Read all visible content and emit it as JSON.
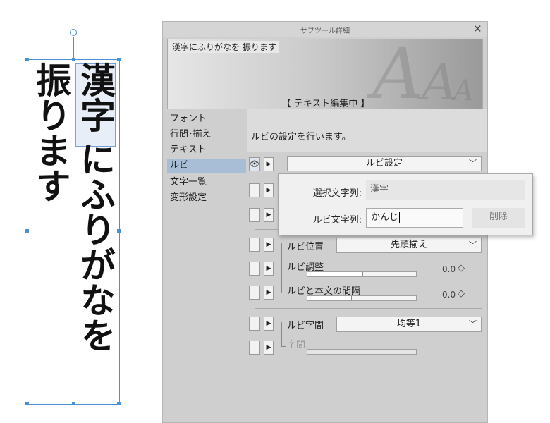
{
  "canvas": {
    "kanji": "漢字",
    "right_rest": "にふりがなを",
    "left_column": "振ります"
  },
  "panel": {
    "title": "サブツール詳細",
    "close_glyph": "✕",
    "preview": {
      "tool_name": "漢字にふりがなを 振ります",
      "status": "【 テキスト編集中 】",
      "glyph_A": "A"
    },
    "categories": [
      "フォント",
      "行間･揃え",
      "テキスト",
      "ルビ",
      "文字一覧",
      "変形設定"
    ],
    "selected_category": "ルビ",
    "description": "ルビの設定を行います。",
    "ruby_setting_label": "ルビ設定",
    "ruby_position_label": "ルビ位置",
    "ruby_position_value": "先頭揃え",
    "ruby_adjust_label": "ルビ調整",
    "ruby_adjust_value": "0.0",
    "ruby_gap_label": "ルビと本文の間隔",
    "ruby_gap_value": "0.0",
    "ruby_spacing_label": "ルビ字間",
    "ruby_spacing_value": "均等1",
    "char_spacing_label": "字間",
    "chevron_down": "﹀",
    "spin_glyph": "◇",
    "play_glyph": "▶",
    "eye_glyph": "👁"
  },
  "popup": {
    "selected_label": "選択文字列:",
    "selected_value": "漢字",
    "ruby_label": "ルビ文字列:",
    "ruby_value": "かんじ",
    "delete_label": "削除"
  }
}
